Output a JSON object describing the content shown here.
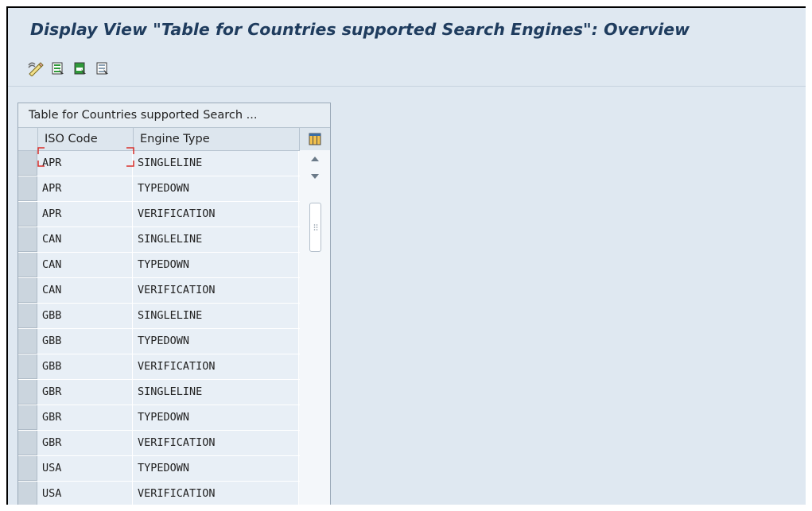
{
  "window": {
    "title": "Display View \"Table for Countries supported Search Engines\": Overview"
  },
  "toolbar": {
    "buttons": [
      {
        "icon": "change-display-icon"
      },
      {
        "icon": "select-all-icon"
      },
      {
        "icon": "select-block-icon"
      },
      {
        "icon": "deselect-all-icon"
      }
    ]
  },
  "table": {
    "caption": "Table for Countries supported Search ...",
    "columns": [
      "ISO Code",
      "Engine Type"
    ],
    "rows": [
      [
        "APR",
        "SINGLELINE"
      ],
      [
        "APR",
        "TYPEDOWN"
      ],
      [
        "APR",
        "VERIFICATION"
      ],
      [
        "CAN",
        "SINGLELINE"
      ],
      [
        "CAN",
        "TYPEDOWN"
      ],
      [
        "CAN",
        "VERIFICATION"
      ],
      [
        "GBB",
        "SINGLELINE"
      ],
      [
        "GBB",
        "TYPEDOWN"
      ],
      [
        "GBB",
        "VERIFICATION"
      ],
      [
        "GBR",
        "SINGLELINE"
      ],
      [
        "GBR",
        "TYPEDOWN"
      ],
      [
        "GBR",
        "VERIFICATION"
      ],
      [
        "USA",
        "TYPEDOWN"
      ],
      [
        "USA",
        "VERIFICATION"
      ],
      [
        "",
        ""
      ]
    ]
  },
  "colors": {
    "title": "#1f3c5e",
    "background": "#dfe8f1",
    "cell_bg": "#e8eff6",
    "focus": "#d9302c"
  }
}
